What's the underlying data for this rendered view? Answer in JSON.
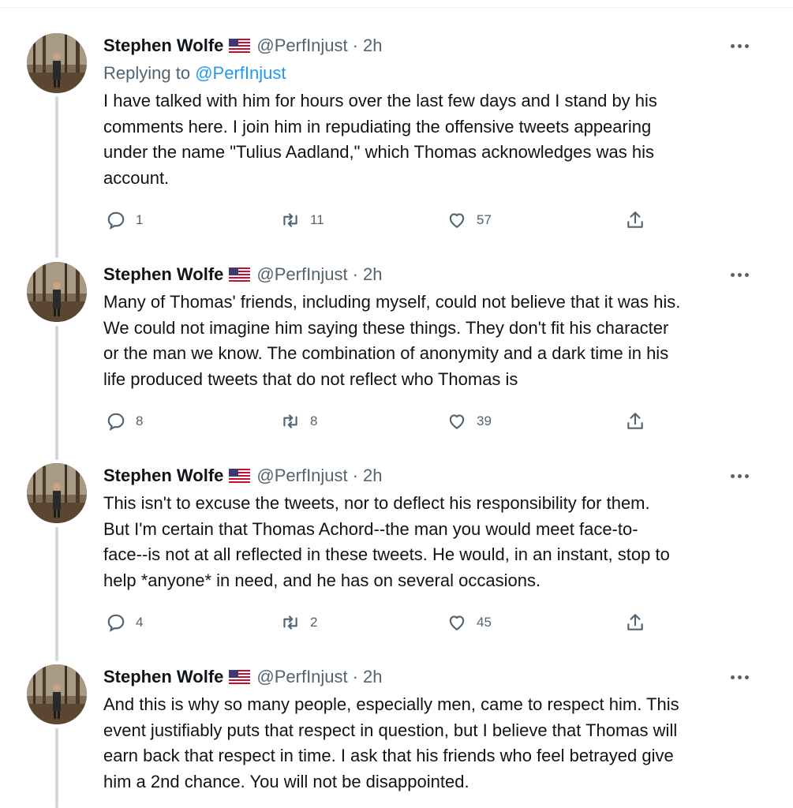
{
  "tweets": [
    {
      "name": "Stephen Wolfe",
      "flag": "us-flag-icon",
      "handle": "@PerfInjust",
      "time": "2h",
      "replying_label": "Replying to",
      "replying_to": "@PerfInjust",
      "lines": [
        "I have talked with him for hours over the last few days and I stand by his",
        "comments here. I join him in repudiating the offensive tweets appearing",
        "under the name \"Tulius Aadland,\" which Thomas acknowledges was his",
        "account."
      ],
      "replies": "1",
      "retweets": "11",
      "likes": "57"
    },
    {
      "name": "Stephen Wolfe",
      "flag": "us-flag-icon",
      "handle": "@PerfInjust",
      "time": "2h",
      "lines": [
        "Many of Thomas' friends, including myself, could not believe that it was his.",
        "We could not imagine him saying these things. They don't fit his character",
        "or the man we know. The combination of anonymity and a dark time in his",
        "life produced tweets that do not reflect who Thomas is"
      ],
      "replies": "8",
      "retweets": "8",
      "likes": "39"
    },
    {
      "name": "Stephen Wolfe",
      "flag": "us-flag-icon",
      "handle": "@PerfInjust",
      "time": "2h",
      "lines": [
        "This isn't to excuse the tweets, nor to deflect his responsibility for them.",
        "But I'm certain that Thomas Achord--the man you would meet face-to-",
        "face--is not at all reflected in these tweets. He would, in an instant, stop to",
        "help *anyone* in need, and he has on several occasions."
      ],
      "replies": "4",
      "retweets": "2",
      "likes": "45"
    },
    {
      "name": "Stephen Wolfe",
      "flag": "us-flag-icon",
      "handle": "@PerfInjust",
      "time": "2h",
      "lines": [
        "And this is why so many people, especially men, came to respect him. This",
        "event justifiably puts that respect in question, but I believe that Thomas will",
        "earn back that respect in time. I ask that his friends who feel betrayed give",
        "him a 2nd chance. You will not be disappointed."
      ]
    }
  ],
  "separator": "·",
  "colors": {
    "text": "#0f1419",
    "secondary": "#536471",
    "link": "#1d9bf0",
    "thread_line": "#cfd9de"
  }
}
